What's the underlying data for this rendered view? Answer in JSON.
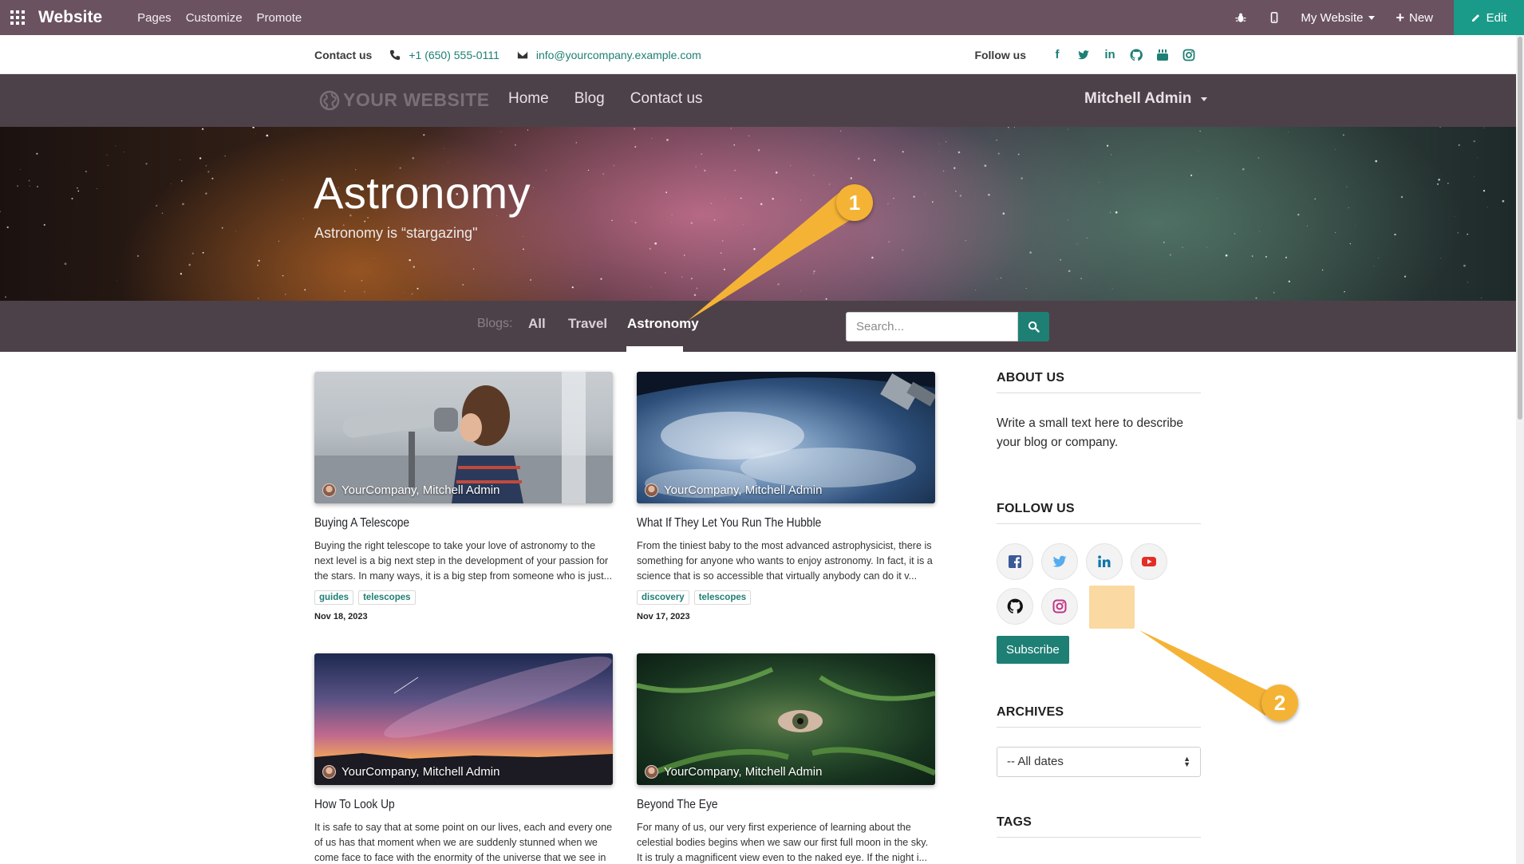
{
  "adminbar": {
    "brand": "Website",
    "menu": [
      "Pages",
      "Customize",
      "Promote"
    ],
    "my_website": "My Website",
    "new_label": "New",
    "edit_label": "Edit"
  },
  "contact": {
    "label": "Contact us",
    "phone": "+1 (650) 555-0111",
    "email": "info@yourcompany.example.com",
    "follow_label": "Follow us"
  },
  "sitenav": {
    "logo": "YOUR WEBSITE",
    "links": [
      "Home",
      "Blog",
      "Contact us"
    ],
    "user": "Mitchell Admin"
  },
  "hero": {
    "title": "Astronomy",
    "subtitle": "Astronomy is “stargazing\""
  },
  "blog_tabs": {
    "label": "Blogs:",
    "tabs": [
      "All",
      "Travel",
      "Astronomy"
    ],
    "active": "Astronomy",
    "search_placeholder": "Search..."
  },
  "posts": [
    {
      "author": "YourCompany, Mitchell Admin",
      "title": "Buying A Telescope",
      "excerpt": "Buying the right telescope to take your love of astronomy to the next level is a big next step in the development of your passion for the stars. In many ways, it is a big step from someone who is just...",
      "tags": [
        "guides",
        "telescopes"
      ],
      "date": "Nov 18, 2023"
    },
    {
      "author": "YourCompany, Mitchell Admin",
      "title": "What If They Let You Run The Hubble",
      "excerpt": "From the tiniest baby to the most advanced astrophysicist, there is something for anyone who wants to enjoy astronomy. In fact, it is a science that is so accessible that virtually anybody can do it v...",
      "tags": [
        "discovery",
        "telescopes"
      ],
      "date": "Nov 17, 2023"
    },
    {
      "author": "YourCompany, Mitchell Admin",
      "title": "How To Look Up",
      "excerpt": "It is safe to say that at some point on our lives, each and every one of us has that moment when we are suddenly stunned when we come face to face with the enormity of the universe that we see in"
    },
    {
      "author": "YourCompany, Mitchell Admin",
      "title": "Beyond The Eye",
      "excerpt": "For many of us, our very first experience of learning about the celestial bodies begins when we saw our first full moon in the sky. It is truly a magnificent view even to the naked eye. If the night i..."
    }
  ],
  "sidebar": {
    "about_title": "ABOUT US",
    "about_text": "Write a small text here to describe your blog or company.",
    "follow_title": "FOLLOW US",
    "subscribe_label": "Subscribe",
    "archives_title": "ARCHIVES",
    "archives_selected": "-- All dates",
    "tags_title": "TAGS"
  },
  "annotations": {
    "callout_1": "1",
    "callout_2": "2"
  },
  "colors": {
    "admin_bar": "#6b5261",
    "site_nav": "#4d4149",
    "accent": "#1e7f74",
    "edit_button": "#1a9b89",
    "callout": "#f5b335"
  }
}
